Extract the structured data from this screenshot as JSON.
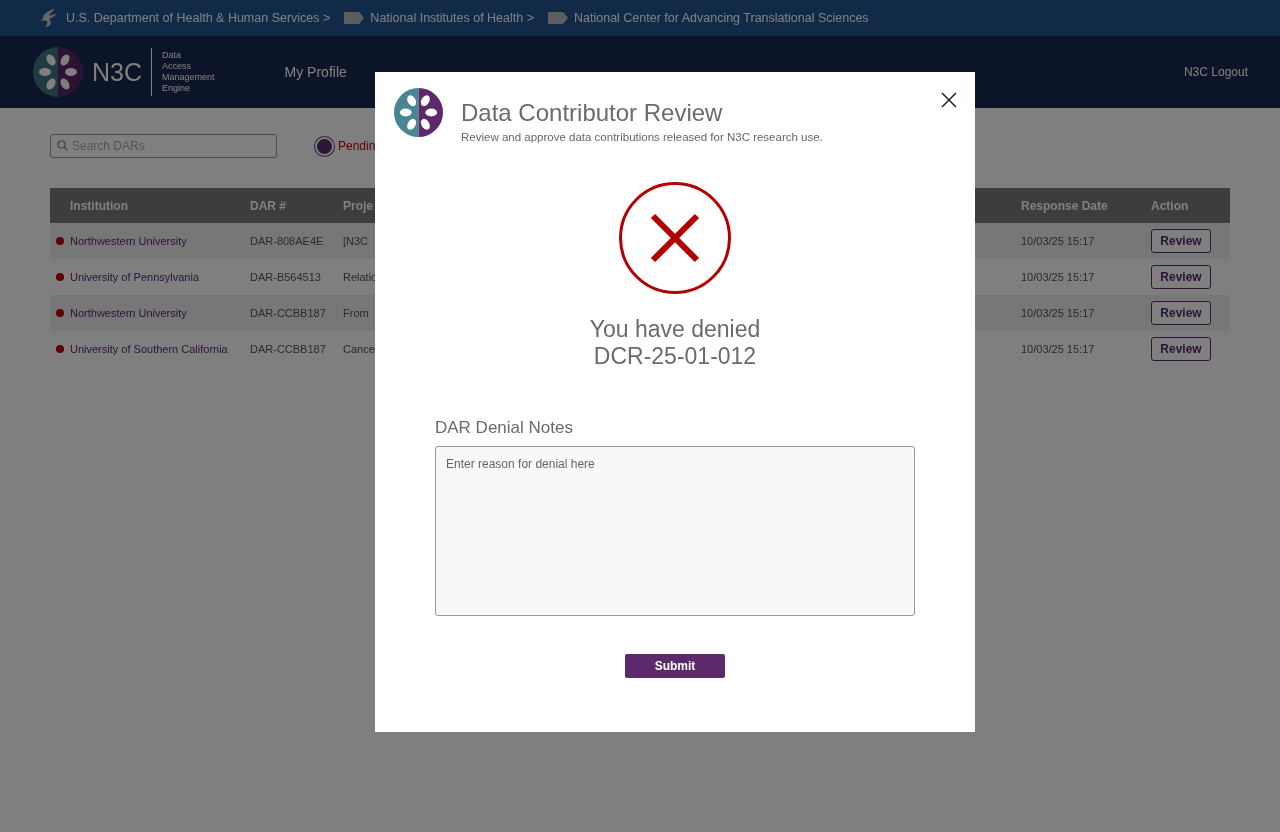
{
  "breadcrumb": [
    "U.S. Department of Health & Human Services >",
    "National Institutes of Health >",
    "National Center for Advancing Translational Sciences"
  ],
  "header": {
    "brand": "N3C",
    "tagline": [
      "Data",
      "Access",
      "Management",
      "Engine"
    ],
    "nav": [
      "My Profile"
    ],
    "logout": "N3C Logout"
  },
  "search": {
    "placeholder": "Search DARs"
  },
  "filters": [
    {
      "label": "Pendin",
      "selected": true
    }
  ],
  "table": {
    "columns": [
      "Institution",
      "DAR #",
      "Proje",
      "Response Date",
      "Action"
    ],
    "rows": [
      {
        "institution": "Northwestern University",
        "dar": "DAR-808AE4E",
        "project": "[N3C",
        "date": "10/03/25 15:17",
        "action": "Review"
      },
      {
        "institution": "University of Pennsylvania",
        "dar": "DAR-B564513",
        "project": "Relatio",
        "date": "10/03/25 15:17",
        "action": "Review"
      },
      {
        "institution": "Northwestern University",
        "dar": "DAR-CCBB187",
        "project": "From",
        "date": "10/03/25 15:17",
        "action": "Review"
      },
      {
        "institution": "University of Southern California",
        "dar": "DAR-CCBB187",
        "project": "Cance",
        "date": "10/03/25 15:17",
        "action": "Review"
      }
    ]
  },
  "modal": {
    "title": "Data Contributor Review",
    "subtitle": "Review and approve data contributions released for N3C research use.",
    "message": [
      "You have denied",
      "DCR-25-01-012"
    ],
    "notes_label": "DAR Denial Notes",
    "notes_placeholder": "Enter reason for denial here",
    "submit": "Submit"
  }
}
